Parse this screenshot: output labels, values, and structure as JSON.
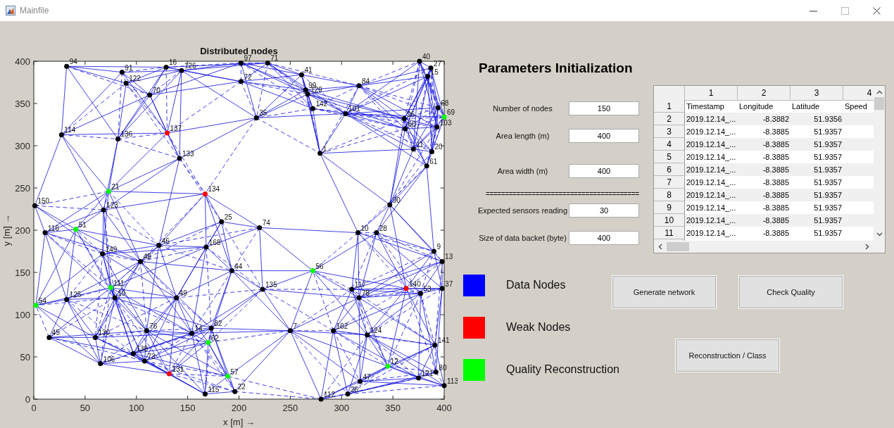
{
  "window": {
    "title": "Mainfile"
  },
  "plot": {
    "chart_data": {
      "type": "scatter",
      "title": "Distributed nodes",
      "xlabel": "x  [m] →",
      "ylabel": "y  [m] →",
      "xlim": [
        0,
        400
      ],
      "ylim": [
        0,
        400
      ],
      "xticks": [
        0,
        50,
        100,
        150,
        200,
        250,
        300,
        350,
        400
      ],
      "yticks": [
        0,
        50,
        100,
        150,
        200,
        250,
        300,
        350,
        400
      ],
      "series": [
        {
          "color": "#000000",
          "x": [
            32,
            86,
            129,
            144,
            202,
            228,
            261,
            317,
            376,
            387,
            384,
            202,
            265,
            267,
            272,
            304,
            361,
            394,
            393,
            362,
            370,
            388,
            383,
            90,
            113,
            217,
            279,
            1,
            27,
            82,
            68,
            142,
            183,
            220,
            334,
            316,
            347,
            11,
            67,
            122,
            104,
            168,
            193,
            223,
            377,
            398,
            390,
            398,
            79,
            32,
            139,
            15,
            60,
            110,
            154,
            173,
            97,
            108,
            65,
            167,
            196,
            250,
            292,
            325,
            391,
            392,
            375,
            318,
            306,
            280,
            400,
            310,
            317
          ],
          "values": [
            394,
            387,
            393,
            389,
            398,
            398,
            384,
            371,
            400,
            392,
            382,
            376,
            366,
            361,
            344,
            338,
            332,
            345,
            322,
            320,
            296,
            293,
            276,
            374,
            360,
            333,
            291,
            229,
            313,
            308,
            224,
            285,
            210,
            203,
            197,
            197,
            230,
            197,
            172,
            182,
            163,
            180,
            152,
            130,
            125,
            131,
            175,
            163,
            120,
            118,
            120,
            73,
            73,
            81,
            78,
            84,
            54,
            45,
            42,
            6,
            9,
            81,
            81,
            76,
            64,
            32,
            25,
            21,
            6,
            0,
            16,
            130,
            120
          ]
        },
        {
          "color": "#ff0000",
          "x": [
            130,
            167,
            132,
            363
          ],
          "values": [
            315,
            243,
            30,
            131
          ]
        },
        {
          "color": "#00ff00",
          "x": [
            400,
            73,
            41,
            75,
            2,
            272,
            170,
            189,
            345
          ],
          "values": [
            334,
            246,
            201,
            132,
            111,
            152,
            67,
            27,
            39
          ]
        }
      ],
      "annotations": [
        {
          "text": "94",
          "x": 32,
          "y": 394
        },
        {
          "text": "91",
          "x": 86,
          "y": 387
        },
        {
          "text": "16",
          "x": 129,
          "y": 393
        },
        {
          "text": "126",
          "x": 144,
          "y": 389
        },
        {
          "text": "97",
          "x": 202,
          "y": 398
        },
        {
          "text": "71",
          "x": 228,
          "y": 398
        },
        {
          "text": "41",
          "x": 261,
          "y": 384
        },
        {
          "text": "84",
          "x": 317,
          "y": 371
        },
        {
          "text": "40",
          "x": 376,
          "y": 400
        },
        {
          "text": "27",
          "x": 387,
          "y": 392
        },
        {
          "text": "15",
          "x": 384,
          "y": 382
        },
        {
          "text": "72",
          "x": 202,
          "y": 376
        },
        {
          "text": "99",
          "x": 265,
          "y": 366
        },
        {
          "text": "129",
          "x": 267,
          "y": 361
        },
        {
          "text": "142",
          "x": 272,
          "y": 344
        },
        {
          "text": "101",
          "x": 304,
          "y": 338
        },
        {
          "text": "96",
          "x": 361,
          "y": 332
        },
        {
          "text": "68",
          "x": 394,
          "y": 345
        },
        {
          "text": "103",
          "x": 393,
          "y": 322
        },
        {
          "text": "60",
          "x": 362,
          "y": 320
        },
        {
          "text": "11",
          "x": 370,
          "y": 296
        },
        {
          "text": "20",
          "x": 388,
          "y": 293
        },
        {
          "text": "61",
          "x": 383,
          "y": 276
        },
        {
          "text": "122",
          "x": 90,
          "y": 374
        },
        {
          "text": "70",
          "x": 113,
          "y": 360
        },
        {
          "text": "35",
          "x": 217,
          "y": 333
        },
        {
          "text": "1",
          "x": 279,
          "y": 291
        },
        {
          "text": "150",
          "x": 1,
          "y": 229
        },
        {
          "text": "114",
          "x": 27,
          "y": 313
        },
        {
          "text": "136",
          "x": 82,
          "y": 308
        },
        {
          "text": "123",
          "x": 68,
          "y": 224
        },
        {
          "text": "133",
          "x": 142,
          "y": 285
        },
        {
          "text": "25",
          "x": 183,
          "y": 210
        },
        {
          "text": "74",
          "x": 220,
          "y": 203
        },
        {
          "text": "28",
          "x": 334,
          "y": 197
        },
        {
          "text": "10",
          "x": 316,
          "y": 197
        },
        {
          "text": "90",
          "x": 347,
          "y": 230
        },
        {
          "text": "116",
          "x": 11,
          "y": 197
        },
        {
          "text": "149",
          "x": 67,
          "y": 172
        },
        {
          "text": "46",
          "x": 122,
          "y": 182
        },
        {
          "text": "48",
          "x": 104,
          "y": 163
        },
        {
          "text": "168",
          "x": 168,
          "y": 180
        },
        {
          "text": "44",
          "x": 193,
          "y": 152
        },
        {
          "text": "135",
          "x": 223,
          "y": 130
        },
        {
          "text": "53",
          "x": 377,
          "y": 125
        },
        {
          "text": "37",
          "x": 398,
          "y": 131
        },
        {
          "text": "9",
          "x": 390,
          "y": 175
        },
        {
          "text": "13",
          "x": 398,
          "y": 163
        },
        {
          "text": "19",
          "x": 79,
          "y": 120
        },
        {
          "text": "125",
          "x": 32,
          "y": 118
        },
        {
          "text": "49",
          "x": 139,
          "y": 120
        },
        {
          "text": "45",
          "x": 15,
          "y": 73
        },
        {
          "text": "130",
          "x": 60,
          "y": 73
        },
        {
          "text": "76",
          "x": 110,
          "y": 81
        },
        {
          "text": "14",
          "x": 154,
          "y": 78
        },
        {
          "text": "82",
          "x": 173,
          "y": 84
        },
        {
          "text": "138",
          "x": 97,
          "y": 54
        },
        {
          "text": "73",
          "x": 108,
          "y": 45
        },
        {
          "text": "106",
          "x": 65,
          "y": 42
        },
        {
          "text": "115",
          "x": 167,
          "y": 6
        },
        {
          "text": "22",
          "x": 196,
          "y": 9
        },
        {
          "text": "7",
          "x": 250,
          "y": 81
        },
        {
          "text": "102",
          "x": 292,
          "y": 81
        },
        {
          "text": "124",
          "x": 325,
          "y": 76
        },
        {
          "text": "141",
          "x": 391,
          "y": 64
        },
        {
          "text": "80",
          "x": 392,
          "y": 32
        },
        {
          "text": "121",
          "x": 375,
          "y": 25
        },
        {
          "text": "47",
          "x": 318,
          "y": 21
        },
        {
          "text": "26",
          "x": 306,
          "y": 6
        },
        {
          "text": "112",
          "x": 280,
          "y": 0
        },
        {
          "text": "113",
          "x": 400,
          "y": 16
        },
        {
          "text": "117",
          "x": 310,
          "y": 130
        },
        {
          "text": "78",
          "x": 317,
          "y": 120
        },
        {
          "text": "137",
          "x": 130,
          "y": 315
        },
        {
          "text": "134",
          "x": 167,
          "y": 243
        },
        {
          "text": "131",
          "x": 132,
          "y": 30
        },
        {
          "text": "140",
          "x": 363,
          "y": 131
        },
        {
          "text": "69",
          "x": 400,
          "y": 334
        },
        {
          "text": "21",
          "x": 73,
          "y": 246
        },
        {
          "text": "51",
          "x": 41,
          "y": 201
        },
        {
          "text": "111",
          "x": 75,
          "y": 132
        },
        {
          "text": "54",
          "x": 2,
          "y": 111
        },
        {
          "text": "56",
          "x": 272,
          "y": 152
        },
        {
          "text": "62",
          "x": 170,
          "y": 67
        },
        {
          "text": "57",
          "x": 189,
          "y": 27
        },
        {
          "text": "12",
          "x": 345,
          "y": 39
        }
      ]
    }
  },
  "parameters": {
    "title": "Parameters Initialization",
    "fields": [
      {
        "kind": "field",
        "label": "Number of nodes",
        "value": "150"
      },
      {
        "kind": "field",
        "label": "Area length (m)",
        "value": "400"
      },
      {
        "kind": "field",
        "label": "Area width (m)",
        "value": "400"
      },
      {
        "kind": "separator",
        "label": "========================================"
      },
      {
        "kind": "field",
        "label": "Expected sensors reading",
        "value": "30"
      },
      {
        "kind": "field",
        "label": "Size of data backet (byte)",
        "value": "400"
      }
    ]
  },
  "table": {
    "columns": [
      "1",
      "2",
      "3",
      "4"
    ],
    "row_headers": [
      "1",
      "2",
      "3",
      "4",
      "5",
      "6",
      "7",
      "8",
      "9",
      "10",
      "11"
    ],
    "rows": [
      [
        "Timestamp",
        "Longitude",
        "Latitude",
        "Speed"
      ],
      [
        "2019.12.14_...",
        "-8.3882",
        "51.9356"
      ],
      [
        "2019.12.14_...",
        "-8.3885",
        "51.9357"
      ],
      [
        "2019.12.14_...",
        "-8.3885",
        "51.9357"
      ],
      [
        "2019.12.14_...",
        "-8.3885",
        "51.9357"
      ],
      [
        "2019.12.14_...",
        "-8.3885",
        "51.9357"
      ],
      [
        "2019.12.14_...",
        "-8.3885",
        "51.9357"
      ],
      [
        "2019.12.14_...",
        "-8.3885",
        "51.9357"
      ],
      [
        "2019.12.14_...",
        "-8.3885",
        "51.9357"
      ],
      [
        "2019.12.14_...",
        "-8.3885",
        "51.9357"
      ],
      [
        "2019.12.14_...",
        "-8.3885",
        "51.9357"
      ]
    ]
  },
  "legend": [
    {
      "label": "Data Nodes",
      "color": "#0000ff"
    },
    {
      "label": "Weak Nodes",
      "color": "#ff0000"
    },
    {
      "label": "Quality Reconstruction",
      "color": "#00ff00"
    }
  ],
  "buttons": [
    "Generate network",
    "Check Quality",
    "Reconstruction / Class"
  ]
}
